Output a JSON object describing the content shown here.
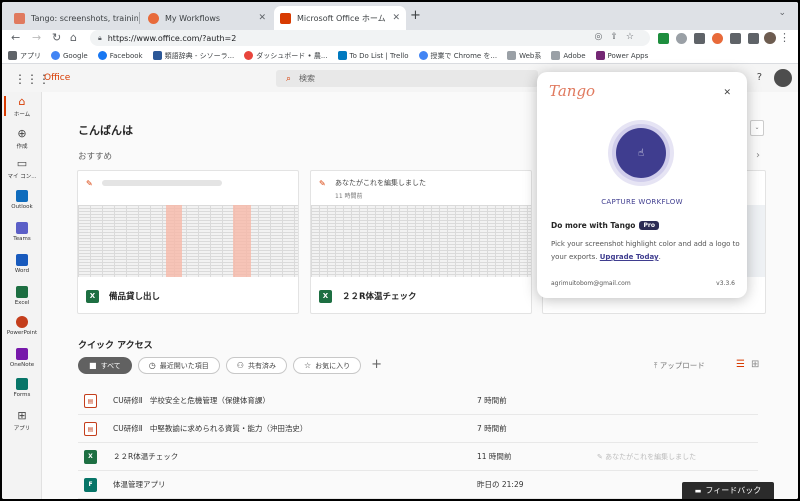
{
  "browser": {
    "tabs": [
      {
        "title": "Tango: screenshots, training, &",
        "active": false
      },
      {
        "title": "My Workflows",
        "active": false
      },
      {
        "title": "Microsoft Office ホーム",
        "active": true
      }
    ],
    "url": "https://www.office.com/?auth=2",
    "bookmarks": [
      "アプリ",
      "Google",
      "Facebook",
      "類語辞典 - シソーラ...",
      "ダッシュボード • 農...",
      "To Do List | Trello",
      "授業で Chrome を...",
      "Web系",
      "Adobe",
      "Power Apps"
    ]
  },
  "office": {
    "brand": "Office",
    "search_placeholder": "検索",
    "help": "?",
    "rail": [
      {
        "label": "ホーム",
        "icon": "home-icon",
        "color": "#d83b01"
      },
      {
        "label": "作成",
        "icon": "create-icon",
        "color": "#444444"
      },
      {
        "label": "マイ コン...",
        "icon": "folder-icon",
        "color": "#444444"
      },
      {
        "label": "Outlook",
        "icon": "outlook-icon",
        "color": "#0f6cbd"
      },
      {
        "label": "Teams",
        "icon": "teams-icon",
        "color": "#5b5fc7"
      },
      {
        "label": "Word",
        "icon": "word-icon",
        "color": "#185abd"
      },
      {
        "label": "Excel",
        "icon": "excel-icon",
        "color": "#1d6f42"
      },
      {
        "label": "PowerPoint",
        "icon": "powerpoint-icon",
        "color": "#c43e1c"
      },
      {
        "label": "OneNote",
        "icon": "onenote-icon",
        "color": "#7719aa"
      },
      {
        "label": "Forms",
        "icon": "forms-icon",
        "color": "#077568"
      },
      {
        "label": "アプリ",
        "icon": "apps-icon",
        "color": "#444444"
      }
    ],
    "greeting": "こんばんは",
    "recommended": "おすすめ",
    "cards": [
      {
        "activity": "",
        "time": "",
        "file": "備品貸し出し"
      },
      {
        "activity": "あなたがこれを編集しました",
        "time": "11 時間前",
        "file": "２２R体温チェック"
      }
    ],
    "quick_access": "クイック アクセス",
    "filters": [
      "すべて",
      "最近開いた項目",
      "共有済み",
      "お気に入り"
    ],
    "upload": "アップロード",
    "files": [
      {
        "name": "CU研修Ⅱ　学校安全と危機管理（保健体育課）",
        "time": "7 時間前",
        "type": "pdf",
        "activity": ""
      },
      {
        "name": "CU研修Ⅱ　中堅教諭に求められる資質・能力（沖田浩史）",
        "time": "7 時間前",
        "type": "pdf",
        "activity": ""
      },
      {
        "name": "２２R体温チェック",
        "time": "11 時間前",
        "type": "xls",
        "activity": "あなたがこれを編集しました"
      },
      {
        "name": "体温管理アプリ",
        "time": "昨日の 21:29",
        "type": "frm",
        "activity": ""
      }
    ],
    "feedback": "フィードバック"
  },
  "tango": {
    "logo": "Tango",
    "capture": "CAPTURE WORKFLOW",
    "domore": "Do more with Tango",
    "pro": "Pro",
    "desc": "Pick your screenshot highlight color and add a logo to your exports.",
    "upgrade": "Upgrade Today",
    "email": "agrimuitobom@gmail.com",
    "version": "v3.3.6"
  }
}
